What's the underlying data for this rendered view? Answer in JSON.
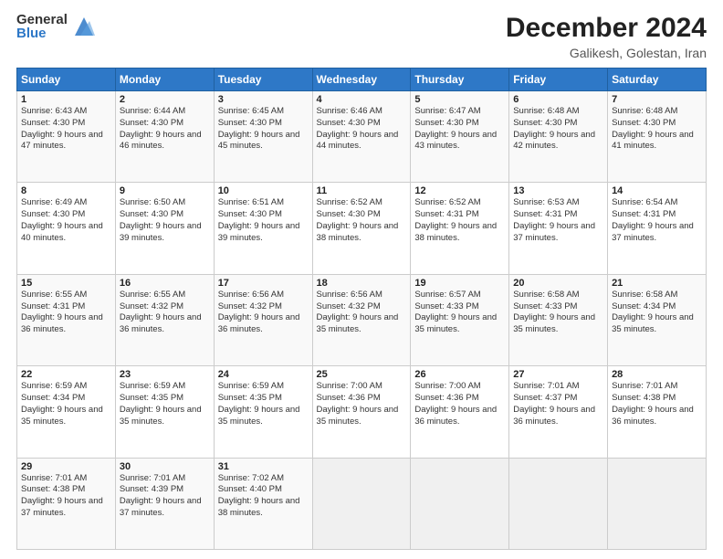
{
  "logo": {
    "general": "General",
    "blue": "Blue"
  },
  "title": {
    "month": "December 2024",
    "location": "Galikesh, Golestan, Iran"
  },
  "headers": [
    "Sunday",
    "Monday",
    "Tuesday",
    "Wednesday",
    "Thursday",
    "Friday",
    "Saturday"
  ],
  "weeks": [
    [
      {
        "day": "1",
        "sunrise": "6:43 AM",
        "sunset": "4:30 PM",
        "daylight": "9 hours and 47 minutes."
      },
      {
        "day": "2",
        "sunrise": "6:44 AM",
        "sunset": "4:30 PM",
        "daylight": "9 hours and 46 minutes."
      },
      {
        "day": "3",
        "sunrise": "6:45 AM",
        "sunset": "4:30 PM",
        "daylight": "9 hours and 45 minutes."
      },
      {
        "day": "4",
        "sunrise": "6:46 AM",
        "sunset": "4:30 PM",
        "daylight": "9 hours and 44 minutes."
      },
      {
        "day": "5",
        "sunrise": "6:47 AM",
        "sunset": "4:30 PM",
        "daylight": "9 hours and 43 minutes."
      },
      {
        "day": "6",
        "sunrise": "6:48 AM",
        "sunset": "4:30 PM",
        "daylight": "9 hours and 42 minutes."
      },
      {
        "day": "7",
        "sunrise": "6:48 AM",
        "sunset": "4:30 PM",
        "daylight": "9 hours and 41 minutes."
      }
    ],
    [
      {
        "day": "8",
        "sunrise": "6:49 AM",
        "sunset": "4:30 PM",
        "daylight": "9 hours and 40 minutes."
      },
      {
        "day": "9",
        "sunrise": "6:50 AM",
        "sunset": "4:30 PM",
        "daylight": "9 hours and 39 minutes."
      },
      {
        "day": "10",
        "sunrise": "6:51 AM",
        "sunset": "4:30 PM",
        "daylight": "9 hours and 39 minutes."
      },
      {
        "day": "11",
        "sunrise": "6:52 AM",
        "sunset": "4:30 PM",
        "daylight": "9 hours and 38 minutes."
      },
      {
        "day": "12",
        "sunrise": "6:52 AM",
        "sunset": "4:31 PM",
        "daylight": "9 hours and 38 minutes."
      },
      {
        "day": "13",
        "sunrise": "6:53 AM",
        "sunset": "4:31 PM",
        "daylight": "9 hours and 37 minutes."
      },
      {
        "day": "14",
        "sunrise": "6:54 AM",
        "sunset": "4:31 PM",
        "daylight": "9 hours and 37 minutes."
      }
    ],
    [
      {
        "day": "15",
        "sunrise": "6:55 AM",
        "sunset": "4:31 PM",
        "daylight": "9 hours and 36 minutes."
      },
      {
        "day": "16",
        "sunrise": "6:55 AM",
        "sunset": "4:32 PM",
        "daylight": "9 hours and 36 minutes."
      },
      {
        "day": "17",
        "sunrise": "6:56 AM",
        "sunset": "4:32 PM",
        "daylight": "9 hours and 36 minutes."
      },
      {
        "day": "18",
        "sunrise": "6:56 AM",
        "sunset": "4:32 PM",
        "daylight": "9 hours and 35 minutes."
      },
      {
        "day": "19",
        "sunrise": "6:57 AM",
        "sunset": "4:33 PM",
        "daylight": "9 hours and 35 minutes."
      },
      {
        "day": "20",
        "sunrise": "6:58 AM",
        "sunset": "4:33 PM",
        "daylight": "9 hours and 35 minutes."
      },
      {
        "day": "21",
        "sunrise": "6:58 AM",
        "sunset": "4:34 PM",
        "daylight": "9 hours and 35 minutes."
      }
    ],
    [
      {
        "day": "22",
        "sunrise": "6:59 AM",
        "sunset": "4:34 PM",
        "daylight": "9 hours and 35 minutes."
      },
      {
        "day": "23",
        "sunrise": "6:59 AM",
        "sunset": "4:35 PM",
        "daylight": "9 hours and 35 minutes."
      },
      {
        "day": "24",
        "sunrise": "6:59 AM",
        "sunset": "4:35 PM",
        "daylight": "9 hours and 35 minutes."
      },
      {
        "day": "25",
        "sunrise": "7:00 AM",
        "sunset": "4:36 PM",
        "daylight": "9 hours and 35 minutes."
      },
      {
        "day": "26",
        "sunrise": "7:00 AM",
        "sunset": "4:36 PM",
        "daylight": "9 hours and 36 minutes."
      },
      {
        "day": "27",
        "sunrise": "7:01 AM",
        "sunset": "4:37 PM",
        "daylight": "9 hours and 36 minutes."
      },
      {
        "day": "28",
        "sunrise": "7:01 AM",
        "sunset": "4:38 PM",
        "daylight": "9 hours and 36 minutes."
      }
    ],
    [
      {
        "day": "29",
        "sunrise": "7:01 AM",
        "sunset": "4:38 PM",
        "daylight": "9 hours and 37 minutes."
      },
      {
        "day": "30",
        "sunrise": "7:01 AM",
        "sunset": "4:39 PM",
        "daylight": "9 hours and 37 minutes."
      },
      {
        "day": "31",
        "sunrise": "7:02 AM",
        "sunset": "4:40 PM",
        "daylight": "9 hours and 38 minutes."
      },
      null,
      null,
      null,
      null
    ]
  ]
}
